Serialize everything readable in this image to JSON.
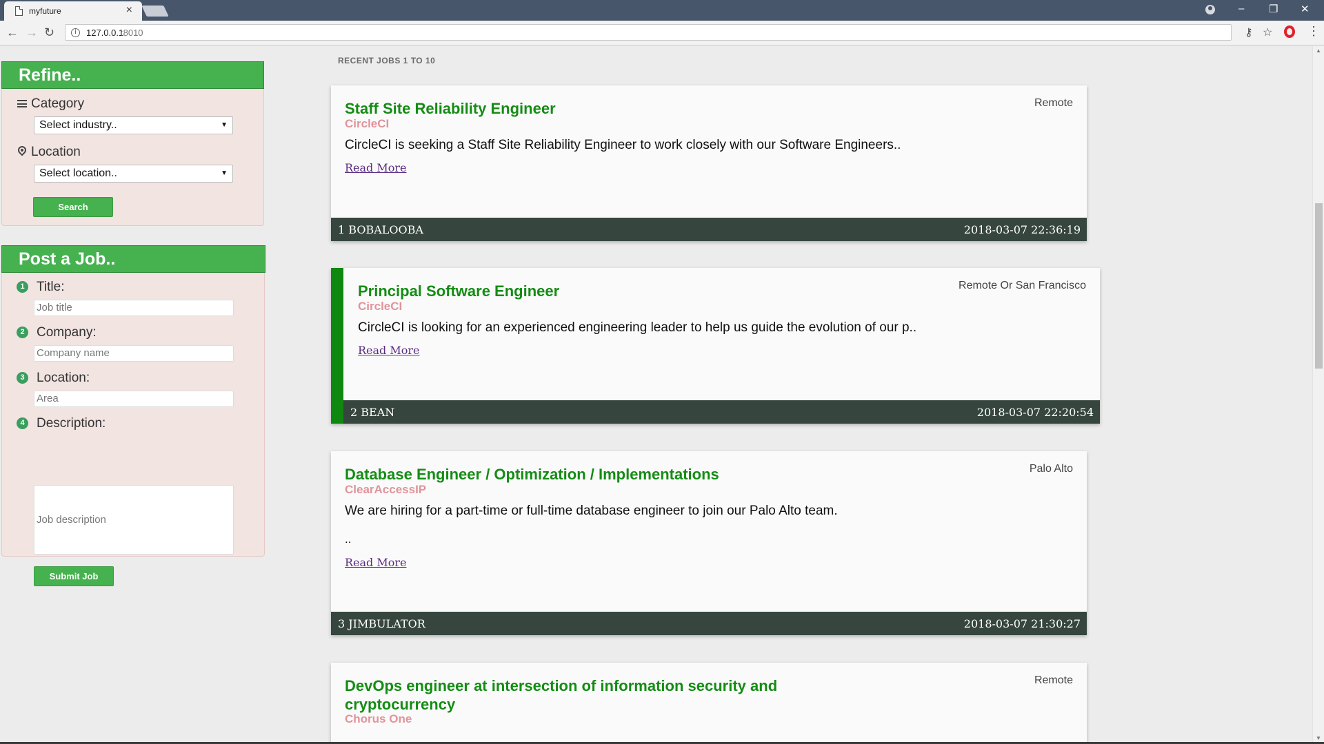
{
  "browser": {
    "tab_title": "myfuture",
    "url_host": "127.0.0.1",
    "url_port": ":8010"
  },
  "refine": {
    "heading": "Refine..",
    "category_label": "Category",
    "category_selected": "Select industry..",
    "location_label": "Location",
    "location_selected": "Select location..",
    "search_label": "Search"
  },
  "post_job": {
    "heading": "Post a Job..",
    "fields": [
      {
        "num": "1",
        "label": "Title:",
        "placeholder": "Job title"
      },
      {
        "num": "2",
        "label": "Company:",
        "placeholder": "Company name"
      },
      {
        "num": "3",
        "label": "Location:",
        "placeholder": "Area"
      },
      {
        "num": "4",
        "label": "Description:",
        "placeholder": "Job description"
      }
    ],
    "submit_label": "Submit Job"
  },
  "jobs_header": "RECENT JOBS 1 TO 10",
  "read_more_label": "Read More",
  "jobs": [
    {
      "title": "Staff Site Reliability Engineer",
      "company": "CircleCI",
      "location": "Remote",
      "description": "CircleCI is seeking a Staff Site Reliability Engineer to work closely with our Software Engineers..",
      "extra": "",
      "poster": "1 BOBALOOBA",
      "timestamp": "2018-03-07 22:36:19"
    },
    {
      "title": "Principal Software Engineer",
      "company": "CircleCI",
      "location": "Remote Or San Francisco",
      "description": "CircleCI is looking for an experienced engineering leader to help us guide the evolution of our p..",
      "extra": "",
      "poster": "2 BEAN",
      "timestamp": "2018-03-07 22:20:54"
    },
    {
      "title": "Database Engineer / Optimization / Implementations",
      "company": "ClearAccessIP",
      "location": "Palo Alto",
      "description": "We are hiring for a part-time or full-time database engineer to join our Palo Alto team.",
      "extra": "..",
      "poster": "3 JIMBULATOR",
      "timestamp": "2018-03-07 21:30:27"
    },
    {
      "title": "DevOps engineer at intersection of information security and cryptocurrency",
      "company": "Chorus One",
      "location": "Remote",
      "description": "",
      "extra": "",
      "poster": "",
      "timestamp": ""
    }
  ],
  "colors": {
    "accent_green": "#46b14f",
    "title_green": "#148c14",
    "company_pink": "#e0949a",
    "footer_dark": "#36463f",
    "panel_bg": "#f1e4e1"
  }
}
